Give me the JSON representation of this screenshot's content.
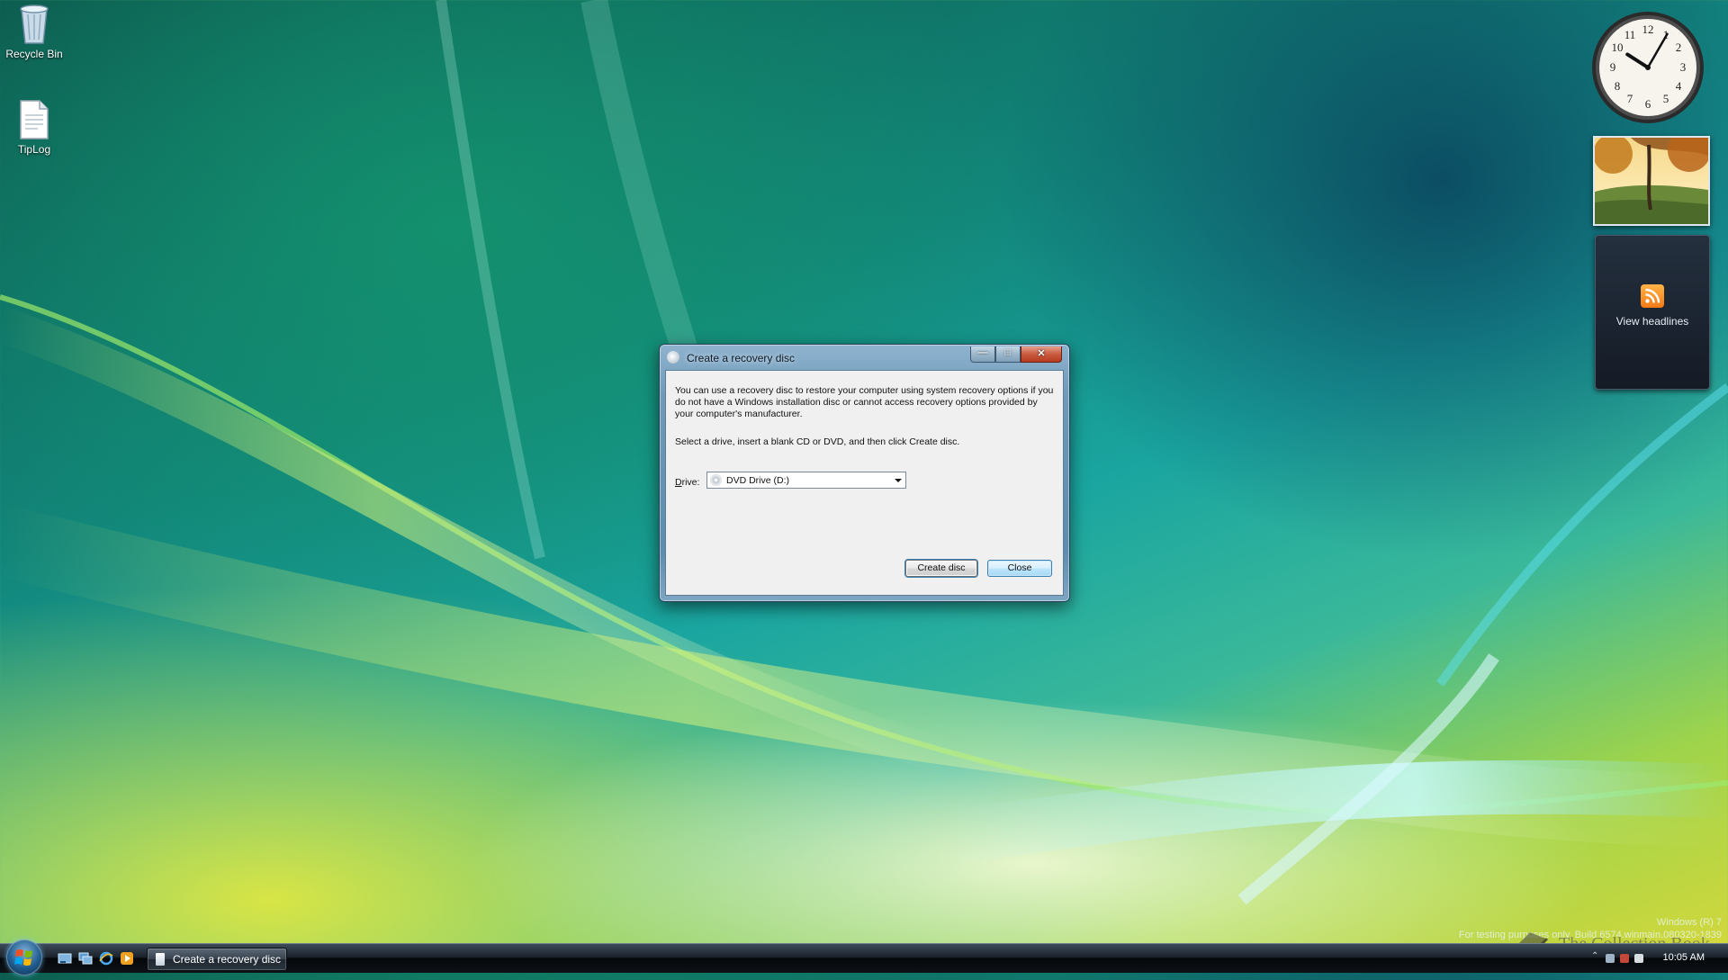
{
  "desktop": {
    "icons": [
      {
        "label": "Recycle Bin",
        "icon": "recycle-bin-icon"
      },
      {
        "label": "TipLog",
        "icon": "text-document-icon"
      }
    ]
  },
  "gadgets": {
    "clock": {
      "hour": 10,
      "minute": 5
    },
    "feed_label": "View headlines"
  },
  "dialog": {
    "title": "Create a recovery disc",
    "message": "You can use a recovery disc to restore your computer using system recovery options if you do not have a Windows installation disc or cannot access recovery options provided by your computer's manufacturer.",
    "instruction": "Select a drive, insert a blank CD or DVD, and then click Create disc.",
    "drive_label_key": "D",
    "drive_label_rest": "rive:",
    "drive_selected": "DVD Drive (D:)",
    "create_button": "Create disc",
    "close_button": "Close"
  },
  "taskbar": {
    "active_window": "Create a recovery disc",
    "time": "10:05 AM"
  },
  "watermark": {
    "line1": "Windows (R) 7",
    "line2": "For testing purposes only. Build 6574.winmain.080320-1839",
    "brand": "The Collection Book"
  },
  "colors": {
    "accent": "#3c7fb1",
    "close_red": "#c95b40",
    "rss_orange": "#f47a16"
  }
}
